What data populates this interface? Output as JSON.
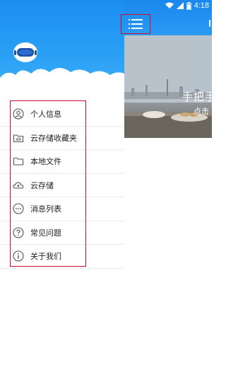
{
  "status_bar": {
    "time": "4:18",
    "icons": [
      "wifi-icon",
      "signal-icon",
      "battery-icon"
    ]
  },
  "drawer": {
    "avatar_icon": "robot-avatar-icon",
    "menu": [
      {
        "label": "个人信息",
        "icon": "person-icon"
      },
      {
        "label": "云存储收藏夹",
        "icon": "cloud-folder-icon"
      },
      {
        "label": "本地文件",
        "icon": "folder-icon"
      },
      {
        "label": "云存储",
        "icon": "cloud-icon"
      },
      {
        "label": "消息列表",
        "icon": "message-icon"
      },
      {
        "label": "常见问题",
        "icon": "question-icon"
      },
      {
        "label": "关于我们",
        "icon": "info-icon"
      }
    ]
  },
  "main": {
    "banner_title": "手把手",
    "banner_subtitle": "点击"
  },
  "colors": {
    "header_blue": "#1b8df2",
    "highlight_red": "#c8102e",
    "icon_gray": "#555555"
  }
}
